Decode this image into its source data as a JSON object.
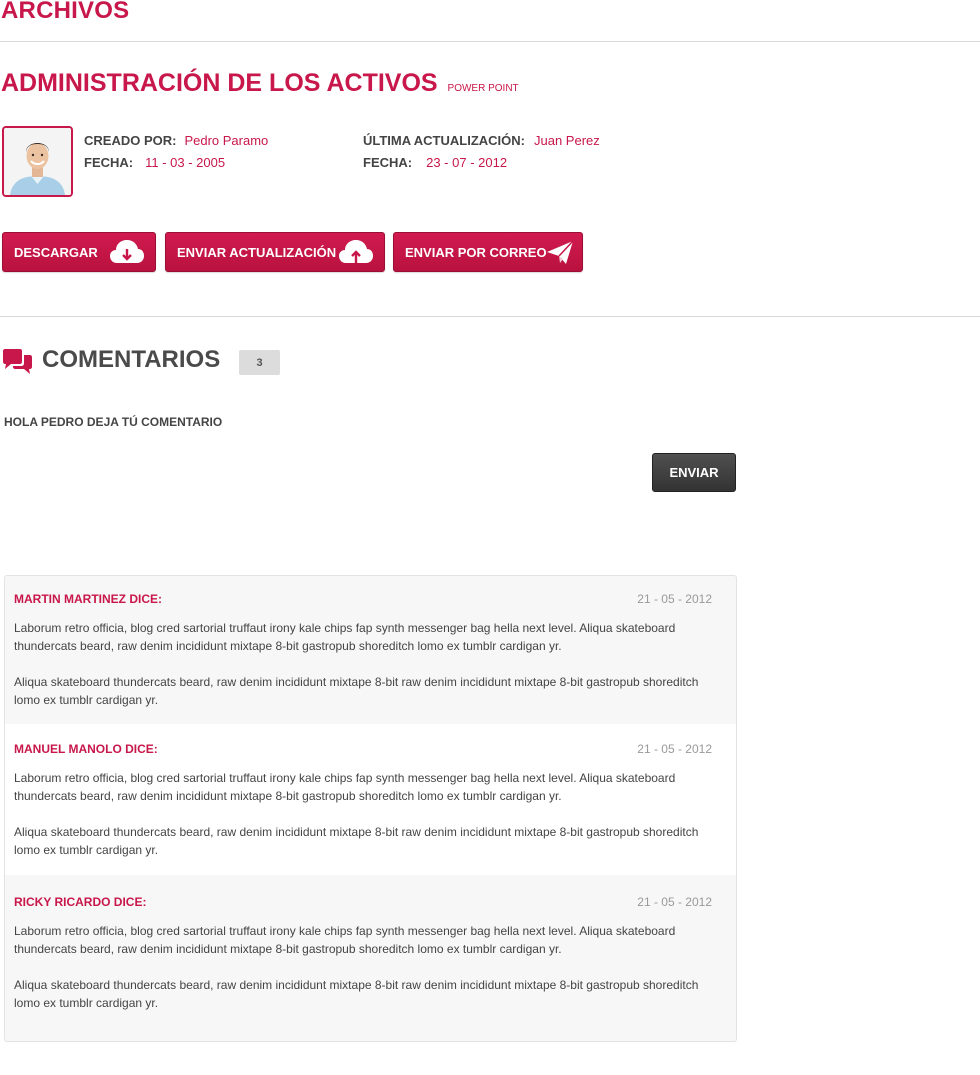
{
  "section": {
    "title": "ARCHIVOS"
  },
  "document": {
    "title": "ADMINISTRACIÓN DE LOS ACTIVOS",
    "type": "POWER POINT",
    "created_by_label": "CREADO POR:",
    "created_by": "Pedro Paramo",
    "created_date_label": "FECHA:",
    "created_date": "11 - 03 - 2005",
    "updated_by_label": "ÚLTIMA ACTUALIZACIÓN:",
    "updated_by": "Juan Perez",
    "updated_date_label": "FECHA:",
    "updated_date": "23 - 07 - 2012"
  },
  "actions": {
    "download": "DESCARGAR",
    "upload": "ENVIAR ACTUALIZACIÓN",
    "email": "ENVIAR POR CORREO"
  },
  "comments_section": {
    "title": "COMENTARIOS",
    "count": "3",
    "prompt": "HOLA PEDRO DEJA TÚ COMENTARIO",
    "send_label": "ENVIAR"
  },
  "comments": [
    {
      "author": "MARTIN MARTINEZ DICE:",
      "date": "21 - 05 - 2012",
      "p1": "Laborum retro officia, blog cred sartorial truffaut irony kale chips fap synth messenger bag hella next level. Aliqua skateboard thundercats beard, raw denim incididunt mixtape 8-bit gastropub shoreditch lomo ex tumblr cardigan yr.",
      "p2": "Aliqua skateboard thundercats beard, raw denim incididunt mixtape 8-bit  raw denim incididunt mixtape 8-bit gastropub shoreditch lomo ex tumblr cardigan yr."
    },
    {
      "author": "MANUEL MANOLO DICE:",
      "date": "21 - 05 - 2012",
      "p1": "Laborum retro officia, blog cred sartorial truffaut irony kale chips fap synth messenger bag hella next level. Aliqua skateboard thundercats beard, raw denim incididunt mixtape 8-bit gastropub shoreditch lomo ex tumblr cardigan yr.",
      "p2": "Aliqua skateboard thundercats beard, raw denim incididunt mixtape 8-bit  raw denim incididunt mixtape 8-bit gastropub shoreditch lomo ex tumblr cardigan yr."
    },
    {
      "author": "RICKY RICARDO DICE:",
      "date": "21 - 05 - 2012",
      "p1": "Laborum retro officia, blog cred sartorial truffaut irony kale chips fap synth messenger bag hella next level. Aliqua skateboard thundercats beard, raw denim incididunt mixtape 8-bit gastropub shoreditch lomo ex tumblr cardigan yr.",
      "p2": "Aliqua skateboard thundercats beard, raw denim incididunt mixtape 8-bit  raw denim incididunt mixtape 8-bit gastropub shoreditch lomo ex tumblr cardigan yr."
    }
  ],
  "icons": {
    "avatar": "user-photo",
    "download": "cloud-download-icon",
    "upload": "cloud-upload-icon",
    "email": "paper-plane-icon",
    "comments": "chat-bubbles-icon"
  },
  "colors": {
    "accent": "#c8174a",
    "dark_button": "#3a3a3a",
    "badge": "#dcdcdc"
  }
}
